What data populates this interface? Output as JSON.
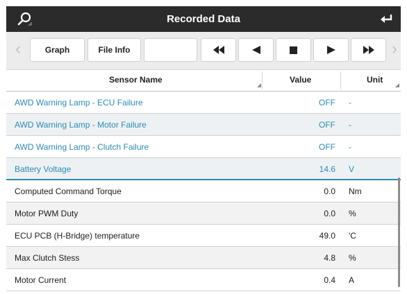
{
  "titlebar": {
    "title": "Recorded Data",
    "icons": [
      "search-icon",
      "back-arrow-icon"
    ]
  },
  "toolbar": {
    "graph_label": "Graph",
    "file_info_label": "File Info",
    "blank_label": "",
    "icons": [
      "chevron-left-icon",
      "rewind-icon",
      "step-back-icon",
      "stop-icon",
      "play-icon",
      "fast-forward-icon",
      "chevron-right-icon"
    ]
  },
  "table": {
    "headers": {
      "name": "Sensor Name",
      "value": "Value",
      "unit": "Unit"
    },
    "pinned_rows": [
      {
        "name": "AWD Warning Lamp - ECU Failure",
        "value": "OFF",
        "unit": "-"
      },
      {
        "name": "AWD Warning Lamp - Motor Failure",
        "value": "OFF",
        "unit": "-"
      },
      {
        "name": "AWD Warning Lamp - Clutch Failure",
        "value": "OFF",
        "unit": "-"
      },
      {
        "name": "Battery Voltage",
        "value": "14.6",
        "unit": "V"
      }
    ],
    "rows": [
      {
        "name": "Computed Command Torque",
        "value": "0.0",
        "unit": "Nm"
      },
      {
        "name": "Motor PWM Duty",
        "value": "0.0",
        "unit": "%"
      },
      {
        "name": "ECU PCB (H-Bridge) temperature",
        "value": "49.0",
        "unit": "'C"
      },
      {
        "name": "Max Clutch Stess",
        "value": "4.8",
        "unit": "%"
      },
      {
        "name": "Motor Current",
        "value": "0.4",
        "unit": "A"
      }
    ]
  },
  "colors": {
    "titlebar": "#2b2b2b",
    "accent": "#2a8bb5",
    "toolbar": "#ececec"
  }
}
